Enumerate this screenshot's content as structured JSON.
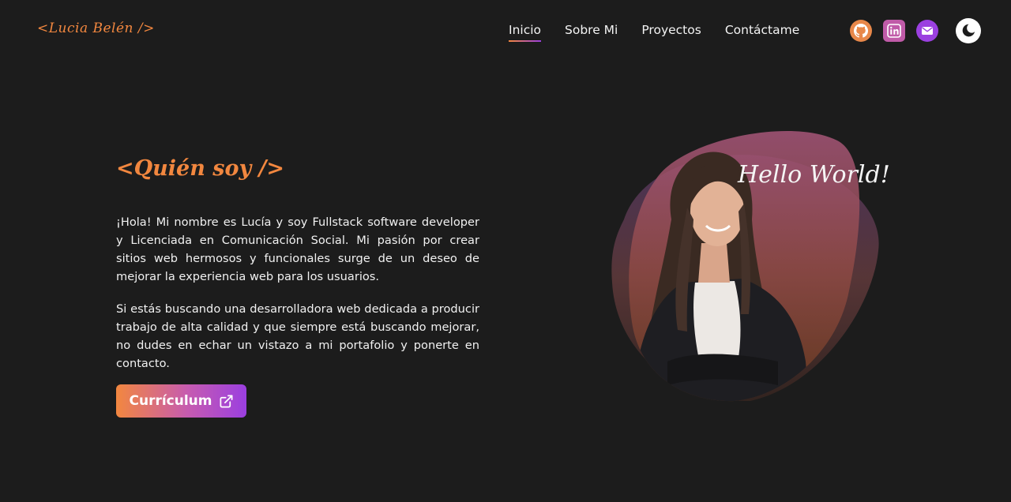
{
  "header": {
    "logo": "<Lucia Belén />",
    "nav": [
      {
        "label": "Inicio",
        "active": true
      },
      {
        "label": "Sobre Mi",
        "active": false
      },
      {
        "label": "Proyectos",
        "active": false
      },
      {
        "label": "Contáctame",
        "active": false
      }
    ],
    "social_icons": [
      "github-icon",
      "linkedin-icon",
      "mail-icon"
    ],
    "theme_icon": "moon-icon"
  },
  "about": {
    "title": "<Quién soy />",
    "paragraphs": [
      "¡Hola! Mi nombre es Lucía y soy Fullstack software developer y Licenciada en Comunicación Social. Mi pasión por crear sitios web hermosos y funcionales surge de un deseo de mejorar la experiencia web para los usuarios.",
      "Si estás buscando una desarrolladora web dedicada a producir trabajo de alta calidad y que siempre está buscando mejorar, no dudes en echar un vistazo a mi portafolio y ponerte en contacto."
    ],
    "cv_button": "Currículum"
  },
  "portrait": {
    "caption": "Hello World!"
  },
  "colors": {
    "background": "#1c1c1c",
    "accent_orange": "#f2873f",
    "accent_purple": "#9b3fe0"
  }
}
